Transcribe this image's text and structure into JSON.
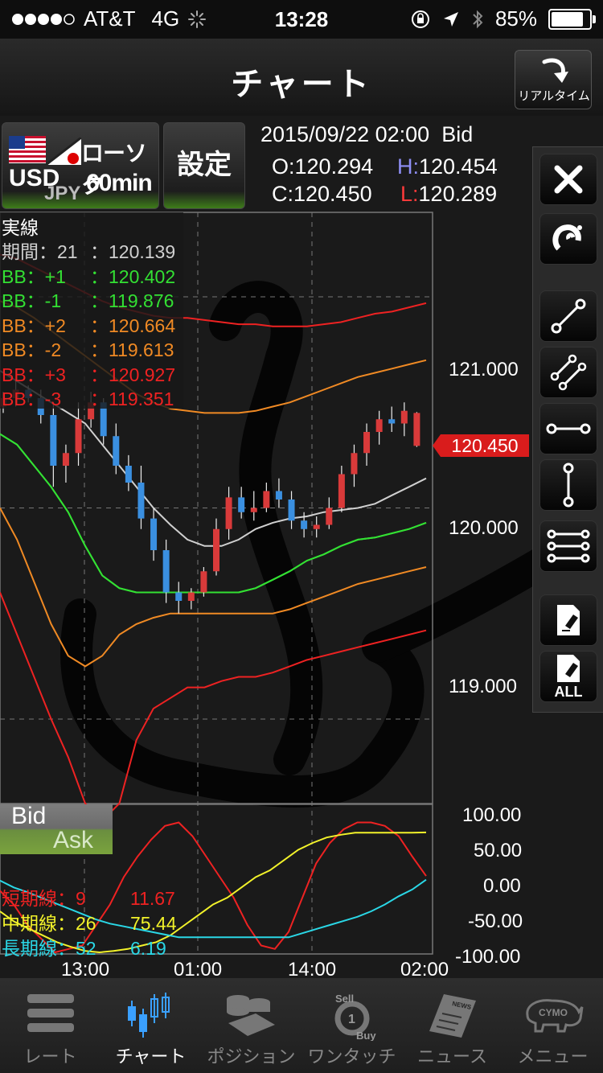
{
  "status_bar": {
    "carrier": "AT&T",
    "network": "4G",
    "time": "13:28",
    "battery_percent": "85%",
    "battery_level": 0.85
  },
  "nav": {
    "title": "チャート",
    "realtime_label": "リアルタイム"
  },
  "symbol": {
    "base": "USD",
    "quote": "JPY",
    "chart_type": "ローソク",
    "interval": "60min"
  },
  "settings_label": "設定",
  "ohlc": {
    "datetime": "2015/09/22 02:00",
    "side": "Bid",
    "o_label": "O:",
    "o_value": "120.294",
    "h_label": "H:",
    "h_value": "120.454",
    "c_label": "C:",
    "c_value": "120.450",
    "l_label": "L:",
    "l_value": "120.289"
  },
  "indicator_panel": {
    "title": "実線",
    "rows": [
      {
        "label": "期間：21",
        "value": "：120.139",
        "color": "#d0d0d0"
      },
      {
        "label": "BB：+1",
        "value": "：120.402",
        "color": "#33e033"
      },
      {
        "label": "BB：-1",
        "value": "：119.876",
        "color": "#33e033"
      },
      {
        "label": "BB：+2",
        "value": "：120.664",
        "color": "#f08a24"
      },
      {
        "label": "BB：-2",
        "value": "：119.613",
        "color": "#f08a24"
      },
      {
        "label": "BB：+3",
        "value": "：120.927",
        "color": "#ee2222"
      },
      {
        "label": "BB：-3",
        "value": "：119.351",
        "color": "#ee2222"
      }
    ]
  },
  "oscillator_panel": {
    "rows": [
      {
        "label": "短期線：9",
        "value": "11.67",
        "color": "#ee2222"
      },
      {
        "label": "中期線：26",
        "value": "75.44",
        "color": "#f2f22a"
      },
      {
        "label": "長期線：52",
        "value": "6.19",
        "color": "#2ad7e6"
      }
    ]
  },
  "bid_ask": {
    "bid": "Bid",
    "ask": "Ask"
  },
  "current_price": "120.450",
  "price_axis": [
    "121.000",
    "120.000",
    "119.000"
  ],
  "osc_axis": [
    "100.00",
    "50.00",
    "0.00",
    "-50.00",
    "-100.00"
  ],
  "time_axis": [
    "13:00",
    "01:00",
    "14:00",
    "02:00"
  ],
  "chart_data": {
    "type": "line",
    "main": {
      "ylim": [
        118.6,
        121.4
      ],
      "series": [
        {
          "name": "期間：21",
          "color": "#d0d0d0",
          "values": [
            120.65,
            120.6,
            120.55,
            120.5,
            120.45,
            120.4,
            120.3,
            120.2,
            120.1,
            120.0,
            119.92,
            119.85,
            119.82,
            119.82,
            119.85,
            119.9,
            119.93,
            119.95,
            119.96,
            119.98,
            119.99,
            120.0,
            120.02,
            120.06,
            120.1,
            120.14
          ]
        },
        {
          "name": "BB：+1",
          "color": "#33e033",
          "values": [
            120.35,
            120.3,
            120.2,
            120.1,
            119.98,
            119.82,
            119.68,
            119.62,
            119.6,
            119.6,
            119.6,
            119.6,
            119.6,
            119.6,
            119.6,
            119.62,
            119.66,
            119.7,
            119.75,
            119.78,
            119.82,
            119.85,
            119.86,
            119.88,
            119.9,
            119.93
          ]
        },
        {
          "name": "BB：-1",
          "color": "#33e033",
          "values": [
            120.35,
            120.3,
            120.2,
            120.1,
            119.98,
            119.82,
            119.68,
            119.62,
            119.6,
            119.6,
            119.6,
            119.6,
            119.6,
            119.6,
            119.6,
            119.62,
            119.66,
            119.7,
            119.75,
            119.78,
            119.82,
            119.85,
            119.86,
            119.88,
            119.9,
            119.93
          ]
        },
        {
          "name": "BB：+2",
          "color": "#f08a24",
          "values": [
            120.98,
            120.95,
            120.9,
            120.84,
            120.78,
            120.72,
            120.66,
            120.6,
            120.54,
            120.5,
            120.47,
            120.46,
            120.45,
            120.45,
            120.45,
            120.46,
            120.48,
            120.5,
            120.53,
            120.56,
            120.59,
            120.62,
            120.64,
            120.66,
            120.68,
            120.7
          ]
        },
        {
          "name": "BB：-2",
          "color": "#f08a24",
          "values": [
            120.0,
            119.85,
            119.65,
            119.45,
            119.3,
            119.25,
            119.3,
            119.4,
            119.45,
            119.48,
            119.5,
            119.5,
            119.5,
            119.5,
            119.5,
            119.5,
            119.5,
            119.52,
            119.55,
            119.58,
            119.61,
            119.64,
            119.66,
            119.68,
            119.7,
            119.72
          ]
        },
        {
          "name": "BB：+3",
          "color": "#ee2222",
          "values": [
            121.2,
            121.18,
            121.14,
            121.1,
            121.06,
            121.02,
            120.98,
            120.95,
            120.93,
            120.91,
            120.9,
            120.9,
            120.89,
            120.88,
            120.87,
            120.87,
            120.86,
            120.86,
            120.86,
            120.87,
            120.88,
            120.9,
            120.92,
            120.93,
            120.95,
            120.97
          ]
        },
        {
          "name": "BB：-3",
          "color": "#ee2222",
          "values": [
            119.6,
            119.4,
            119.2,
            119.0,
            118.82,
            118.6,
            118.52,
            118.6,
            118.9,
            119.05,
            119.1,
            119.15,
            119.15,
            119.18,
            119.2,
            119.2,
            119.22,
            119.25,
            119.28,
            119.3,
            119.32,
            119.34,
            119.36,
            119.38,
            119.4,
            119.42
          ]
        }
      ]
    },
    "oscillator": {
      "ylim": [
        -100,
        100
      ],
      "series": [
        {
          "name": "短期線：9",
          "color": "#ee2222",
          "values": [
            -10,
            -30,
            -60,
            -80,
            -100,
            -95,
            -90,
            -60,
            -30,
            10,
            40,
            65,
            85,
            90,
            70,
            40,
            10,
            -20,
            -60,
            -90,
            -95,
            -70,
            -20,
            30,
            60,
            80,
            90,
            90,
            85,
            70,
            40,
            11.67
          ]
        },
        {
          "name": "中期線：26",
          "color": "#f2f22a",
          "values": [
            -40,
            -55,
            -65,
            -75,
            -85,
            -92,
            -98,
            -100,
            -98,
            -95,
            -90,
            -85,
            -75,
            -60,
            -45,
            -30,
            -20,
            -5,
            10,
            20,
            35,
            50,
            60,
            68,
            72,
            75,
            75,
            75,
            75,
            75,
            75.44
          ]
        },
        {
          "name": "長期線：52",
          "color": "#2ad7e6",
          "values": [
            5,
            -5,
            -12,
            -20,
            -28,
            -36,
            -44,
            -52,
            -58,
            -62,
            -66,
            -70,
            -74,
            -78,
            -78,
            -78,
            -78,
            -78,
            -78,
            -78,
            -78,
            -78,
            -72,
            -66,
            -60,
            -54,
            -48,
            -40,
            -30,
            -18,
            -8,
            6.19
          ]
        }
      ]
    },
    "candles": [
      [
        120.48,
        120.55,
        120.45,
        120.52
      ],
      [
        120.52,
        120.6,
        120.48,
        120.56
      ],
      [
        120.56,
        120.58,
        120.5,
        120.52
      ],
      [
        120.52,
        120.56,
        120.4,
        120.44
      ],
      [
        120.44,
        120.5,
        120.1,
        120.2
      ],
      [
        120.2,
        120.3,
        120.12,
        120.26
      ],
      [
        120.26,
        120.5,
        120.2,
        120.42
      ],
      [
        120.42,
        120.55,
        120.38,
        120.5
      ],
      [
        120.5,
        120.52,
        120.3,
        120.34
      ],
      [
        120.34,
        120.4,
        120.16,
        120.2
      ],
      [
        120.2,
        120.25,
        120.08,
        120.12
      ],
      [
        120.12,
        120.2,
        119.9,
        119.95
      ],
      [
        119.95,
        120.0,
        119.75,
        119.8
      ],
      [
        119.8,
        119.85,
        119.55,
        119.6
      ],
      [
        119.6,
        119.65,
        119.5,
        119.56
      ],
      [
        119.56,
        119.62,
        119.52,
        119.6
      ],
      [
        119.6,
        119.72,
        119.58,
        119.7
      ],
      [
        119.7,
        119.95,
        119.68,
        119.9
      ],
      [
        119.9,
        120.1,
        119.85,
        120.05
      ],
      [
        120.05,
        120.1,
        119.95,
        119.98
      ],
      [
        119.98,
        120.08,
        119.94,
        120.0
      ],
      [
        120.0,
        120.12,
        119.98,
        120.08
      ],
      [
        120.08,
        120.14,
        120.0,
        120.04
      ],
      [
        120.04,
        120.08,
        119.9,
        119.94
      ],
      [
        119.94,
        119.98,
        119.86,
        119.9
      ],
      [
        119.9,
        119.96,
        119.86,
        119.92
      ],
      [
        119.92,
        120.05,
        119.9,
        120.0
      ],
      [
        120.0,
        120.2,
        119.98,
        120.16
      ],
      [
        120.16,
        120.3,
        120.1,
        120.26
      ],
      [
        120.26,
        120.4,
        120.2,
        120.36
      ],
      [
        120.36,
        120.46,
        120.3,
        120.42
      ],
      [
        120.42,
        120.48,
        120.36,
        120.4
      ],
      [
        120.4,
        120.5,
        120.34,
        120.46
      ],
      [
        120.294,
        120.454,
        120.289,
        120.45
      ]
    ]
  }
}
